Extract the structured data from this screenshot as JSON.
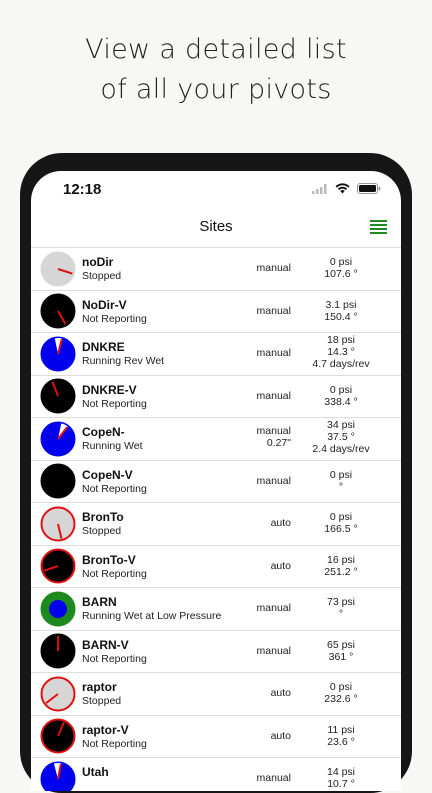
{
  "headline": {
    "line1": "View a detailed list",
    "line2": "of all your pivots"
  },
  "statusbar": {
    "time": "12:18"
  },
  "nav": {
    "title": "Sites"
  },
  "sites": [
    {
      "name": "noDir",
      "status": "Stopped",
      "mode": "manual",
      "mode2": "",
      "v1": "0 psi",
      "v2": "107.6 °",
      "v3": "",
      "fill": "#d6d6d6",
      "ring": "#d6d6d6",
      "ring_w": 1,
      "angle": 107.6,
      "hand": "#e01010",
      "wedge": ""
    },
    {
      "name": "NoDir-V",
      "status": "Not Reporting",
      "mode": "manual",
      "mode2": "",
      "v1": "3.1 psi",
      "v2": "150.4 °",
      "v3": "",
      "fill": "#000000",
      "ring": "#000000",
      "ring_w": 1,
      "angle": 150.4,
      "hand": "#e01010",
      "wedge": ""
    },
    {
      "name": "DNKRE",
      "status": "Running Rev Wet",
      "mode": "manual",
      "mode2": "",
      "v1": "18 psi",
      "v2": "14.3 °",
      "v3": "4.7 days/rev",
      "fill": "#0000ee",
      "ring": "#0000ee",
      "ring_w": 1,
      "angle": 14.3,
      "hand": "#e01010",
      "wedge": "#ffffff"
    },
    {
      "name": "DNKRE-V",
      "status": "Not Reporting",
      "mode": "manual",
      "mode2": "",
      "v1": "0 psi",
      "v2": "338.4 °",
      "v3": "",
      "fill": "#000000",
      "ring": "#000000",
      "ring_w": 1,
      "angle": 338.4,
      "hand": "#e01010",
      "wedge": ""
    },
    {
      "name": "CopeN-",
      "status": "Running Wet",
      "mode": "manual",
      "mode2": "0.27\"",
      "v1": "34 psi",
      "v2": "37.5 °",
      "v3": "2.4 days/rev",
      "fill": "#0000ee",
      "ring": "#0000ee",
      "ring_w": 1,
      "angle": 37.5,
      "hand": "#e01010",
      "wedge": "#ffffff"
    },
    {
      "name": "CopeN-V",
      "status": "Not Reporting",
      "mode": "manual",
      "mode2": "",
      "v1": "0 psi",
      "v2": "°",
      "v3": "",
      "fill": "#000000",
      "ring": "#000000",
      "ring_w": 1,
      "angle": null,
      "hand": "#e01010",
      "wedge": ""
    },
    {
      "name": "BronTo",
      "status": "Stopped",
      "mode": "auto",
      "mode2": "",
      "v1": "0 psi",
      "v2": "166.5 °",
      "v3": "",
      "fill": "#d6d6d6",
      "ring": "#e01010",
      "ring_w": 2,
      "angle": 166.5,
      "hand": "#e01010",
      "wedge": ""
    },
    {
      "name": "BronTo-V",
      "status": "Not Reporting",
      "mode": "auto",
      "mode2": "",
      "v1": "16 psi",
      "v2": "251.2 °",
      "v3": "",
      "fill": "#000000",
      "ring": "#e01010",
      "ring_w": 2,
      "angle": 251.2,
      "hand": "#e01010",
      "wedge": ""
    },
    {
      "name": "BARN",
      "status": "Running Wet at Low Pressure",
      "mode": "manual",
      "mode2": "",
      "v1": "73 psi",
      "v2": "°",
      "v3": "",
      "fill": "#1e8a1e",
      "ring": "#1e8a1e",
      "ring_w": 1,
      "angle": null,
      "hand": "#e01010",
      "wedge": "",
      "center": "#0000ee"
    },
    {
      "name": "BARN-V",
      "status": "Not Reporting",
      "mode": "manual",
      "mode2": "",
      "v1": "65 psi",
      "v2": "361 °",
      "v3": "",
      "fill": "#000000",
      "ring": "#000000",
      "ring_w": 1,
      "angle": 361,
      "hand": "#e01010",
      "wedge": ""
    },
    {
      "name": "raptor",
      "status": "Stopped",
      "mode": "auto",
      "mode2": "",
      "v1": "0 psi",
      "v2": "232.6 °",
      "v3": "",
      "fill": "#d6d6d6",
      "ring": "#e01010",
      "ring_w": 2,
      "angle": 232.6,
      "hand": "#e01010",
      "wedge": ""
    },
    {
      "name": "raptor-V",
      "status": "Not Reporting",
      "mode": "auto",
      "mode2": "",
      "v1": "11 psi",
      "v2": "23.6 °",
      "v3": "",
      "fill": "#000000",
      "ring": "#e01010",
      "ring_w": 2,
      "angle": 23.6,
      "hand": "#e01010",
      "wedge": ""
    },
    {
      "name": "Utah",
      "status": "",
      "mode": "manual",
      "mode2": "",
      "v1": "14 psi",
      "v2": "10.7 °",
      "v3": "",
      "fill": "#0000ee",
      "ring": "#0000ee",
      "ring_w": 1,
      "angle": 10.7,
      "hand": "#e01010",
      "wedge": "#ffffff"
    }
  ]
}
